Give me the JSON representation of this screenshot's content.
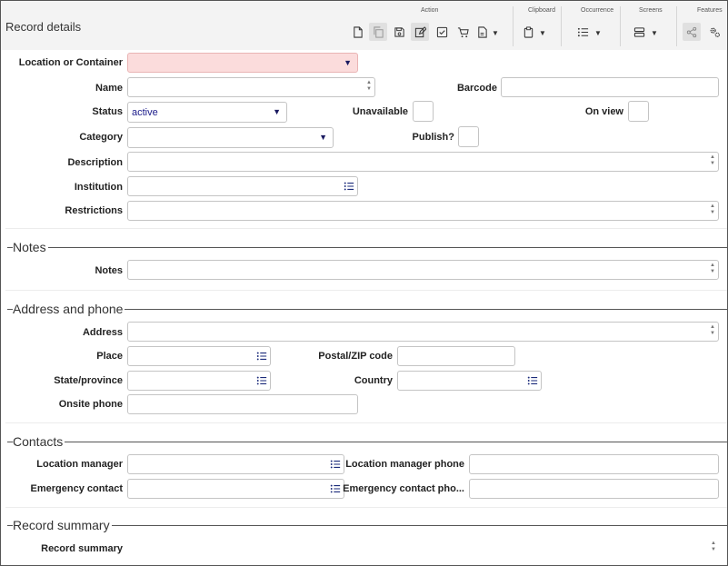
{
  "header": {
    "title": "Record details"
  },
  "toolbar": {
    "groups": {
      "action": "Action",
      "clipboard": "Clipboard",
      "occurrence": "Occurrence",
      "screens": "Screens",
      "features": "Features"
    },
    "dropdown_glyph": "▼"
  },
  "form": {
    "location": {
      "label": "Location or Container",
      "value": ""
    },
    "name": {
      "label": "Name",
      "value": ""
    },
    "barcode": {
      "label": "Barcode",
      "value": ""
    },
    "status": {
      "label": "Status",
      "value": "active"
    },
    "unavailable": {
      "label": "Unavailable",
      "checked": false
    },
    "on_view": {
      "label": "On view",
      "checked": false
    },
    "category": {
      "label": "Category",
      "value": ""
    },
    "publish": {
      "label": "Publish?",
      "checked": false
    },
    "description": {
      "label": "Description",
      "value": ""
    },
    "institution": {
      "label": "Institution",
      "value": ""
    },
    "restrictions": {
      "label": "Restrictions",
      "value": ""
    }
  },
  "notes": {
    "title": "Notes",
    "notes": {
      "label": "Notes",
      "value": ""
    }
  },
  "address": {
    "title": "Address and phone",
    "address": {
      "label": "Address",
      "value": ""
    },
    "place": {
      "label": "Place",
      "value": ""
    },
    "postal": {
      "label": "Postal/ZIP code",
      "value": ""
    },
    "state": {
      "label": "State/province",
      "value": ""
    },
    "country": {
      "label": "Country",
      "value": ""
    },
    "onsite_phone": {
      "label": "Onsite phone",
      "value": ""
    }
  },
  "contacts": {
    "title": "Contacts",
    "manager": {
      "label": "Location manager",
      "value": ""
    },
    "manager_phone": {
      "label": "Location manager phone",
      "value": ""
    },
    "emergency": {
      "label": "Emergency contact",
      "value": ""
    },
    "emergency_phone": {
      "label": "Emergency contact pho...",
      "value": ""
    }
  },
  "summary": {
    "title": "Record summary",
    "record_summary": {
      "label": "Record summary",
      "value": ""
    }
  },
  "colors": {
    "required_field": "#fbdcdc",
    "accent": "#1a1a8a",
    "toolbar_bg": "#f3f3f3"
  },
  "icons": [
    "new-record-icon",
    "duplicate-icon",
    "save-icon",
    "edit-icon",
    "check-icon",
    "cart-icon",
    "report-icon",
    "clipboard-icon",
    "list-icon",
    "screens-icon",
    "share-icon",
    "settings-icon"
  ]
}
